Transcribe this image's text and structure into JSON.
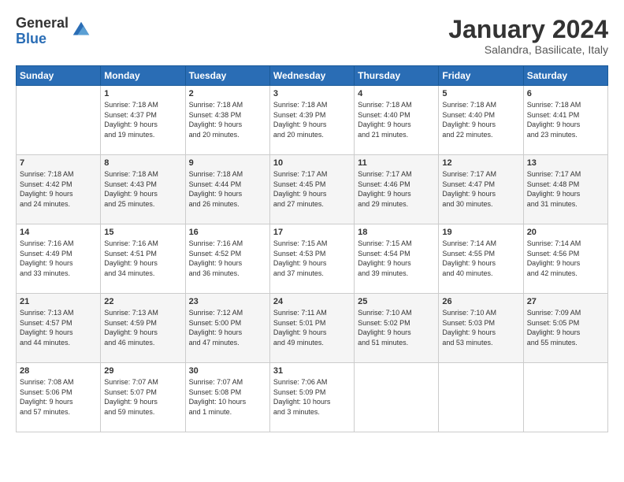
{
  "header": {
    "logo_general": "General",
    "logo_blue": "Blue",
    "month_title": "January 2024",
    "subtitle": "Salandra, Basilicate, Italy"
  },
  "days_of_week": [
    "Sunday",
    "Monday",
    "Tuesday",
    "Wednesday",
    "Thursday",
    "Friday",
    "Saturday"
  ],
  "weeks": [
    [
      {
        "day": "",
        "info": ""
      },
      {
        "day": "1",
        "info": "Sunrise: 7:18 AM\nSunset: 4:37 PM\nDaylight: 9 hours\nand 19 minutes."
      },
      {
        "day": "2",
        "info": "Sunrise: 7:18 AM\nSunset: 4:38 PM\nDaylight: 9 hours\nand 20 minutes."
      },
      {
        "day": "3",
        "info": "Sunrise: 7:18 AM\nSunset: 4:39 PM\nDaylight: 9 hours\nand 20 minutes."
      },
      {
        "day": "4",
        "info": "Sunrise: 7:18 AM\nSunset: 4:40 PM\nDaylight: 9 hours\nand 21 minutes."
      },
      {
        "day": "5",
        "info": "Sunrise: 7:18 AM\nSunset: 4:40 PM\nDaylight: 9 hours\nand 22 minutes."
      },
      {
        "day": "6",
        "info": "Sunrise: 7:18 AM\nSunset: 4:41 PM\nDaylight: 9 hours\nand 23 minutes."
      }
    ],
    [
      {
        "day": "7",
        "info": "Sunrise: 7:18 AM\nSunset: 4:42 PM\nDaylight: 9 hours\nand 24 minutes."
      },
      {
        "day": "8",
        "info": "Sunrise: 7:18 AM\nSunset: 4:43 PM\nDaylight: 9 hours\nand 25 minutes."
      },
      {
        "day": "9",
        "info": "Sunrise: 7:18 AM\nSunset: 4:44 PM\nDaylight: 9 hours\nand 26 minutes."
      },
      {
        "day": "10",
        "info": "Sunrise: 7:17 AM\nSunset: 4:45 PM\nDaylight: 9 hours\nand 27 minutes."
      },
      {
        "day": "11",
        "info": "Sunrise: 7:17 AM\nSunset: 4:46 PM\nDaylight: 9 hours\nand 29 minutes."
      },
      {
        "day": "12",
        "info": "Sunrise: 7:17 AM\nSunset: 4:47 PM\nDaylight: 9 hours\nand 30 minutes."
      },
      {
        "day": "13",
        "info": "Sunrise: 7:17 AM\nSunset: 4:48 PM\nDaylight: 9 hours\nand 31 minutes."
      }
    ],
    [
      {
        "day": "14",
        "info": "Sunrise: 7:16 AM\nSunset: 4:49 PM\nDaylight: 9 hours\nand 33 minutes."
      },
      {
        "day": "15",
        "info": "Sunrise: 7:16 AM\nSunset: 4:51 PM\nDaylight: 9 hours\nand 34 minutes."
      },
      {
        "day": "16",
        "info": "Sunrise: 7:16 AM\nSunset: 4:52 PM\nDaylight: 9 hours\nand 36 minutes."
      },
      {
        "day": "17",
        "info": "Sunrise: 7:15 AM\nSunset: 4:53 PM\nDaylight: 9 hours\nand 37 minutes."
      },
      {
        "day": "18",
        "info": "Sunrise: 7:15 AM\nSunset: 4:54 PM\nDaylight: 9 hours\nand 39 minutes."
      },
      {
        "day": "19",
        "info": "Sunrise: 7:14 AM\nSunset: 4:55 PM\nDaylight: 9 hours\nand 40 minutes."
      },
      {
        "day": "20",
        "info": "Sunrise: 7:14 AM\nSunset: 4:56 PM\nDaylight: 9 hours\nand 42 minutes."
      }
    ],
    [
      {
        "day": "21",
        "info": "Sunrise: 7:13 AM\nSunset: 4:57 PM\nDaylight: 9 hours\nand 44 minutes."
      },
      {
        "day": "22",
        "info": "Sunrise: 7:13 AM\nSunset: 4:59 PM\nDaylight: 9 hours\nand 46 minutes."
      },
      {
        "day": "23",
        "info": "Sunrise: 7:12 AM\nSunset: 5:00 PM\nDaylight: 9 hours\nand 47 minutes."
      },
      {
        "day": "24",
        "info": "Sunrise: 7:11 AM\nSunset: 5:01 PM\nDaylight: 9 hours\nand 49 minutes."
      },
      {
        "day": "25",
        "info": "Sunrise: 7:10 AM\nSunset: 5:02 PM\nDaylight: 9 hours\nand 51 minutes."
      },
      {
        "day": "26",
        "info": "Sunrise: 7:10 AM\nSunset: 5:03 PM\nDaylight: 9 hours\nand 53 minutes."
      },
      {
        "day": "27",
        "info": "Sunrise: 7:09 AM\nSunset: 5:05 PM\nDaylight: 9 hours\nand 55 minutes."
      }
    ],
    [
      {
        "day": "28",
        "info": "Sunrise: 7:08 AM\nSunset: 5:06 PM\nDaylight: 9 hours\nand 57 minutes."
      },
      {
        "day": "29",
        "info": "Sunrise: 7:07 AM\nSunset: 5:07 PM\nDaylight: 9 hours\nand 59 minutes."
      },
      {
        "day": "30",
        "info": "Sunrise: 7:07 AM\nSunset: 5:08 PM\nDaylight: 10 hours\nand 1 minute."
      },
      {
        "day": "31",
        "info": "Sunrise: 7:06 AM\nSunset: 5:09 PM\nDaylight: 10 hours\nand 3 minutes."
      },
      {
        "day": "",
        "info": ""
      },
      {
        "day": "",
        "info": ""
      },
      {
        "day": "",
        "info": ""
      }
    ]
  ]
}
